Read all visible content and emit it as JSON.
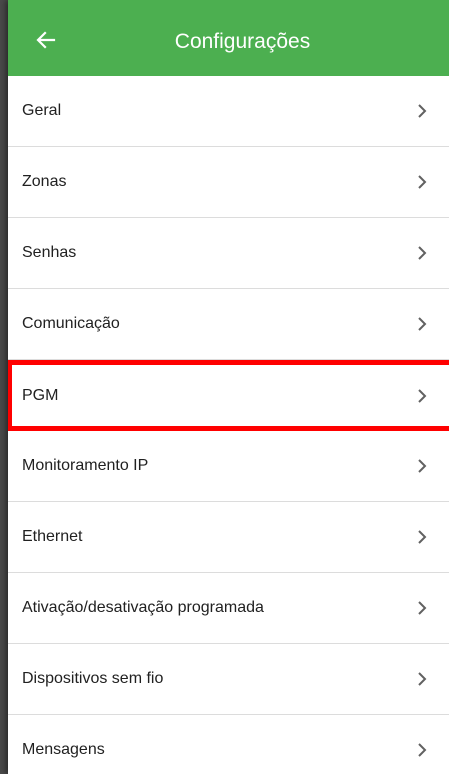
{
  "header": {
    "title": "Configurações",
    "back_icon": "arrow-left-icon",
    "bg_color": "#4caf50"
  },
  "settings": {
    "items": [
      {
        "label": "Geral"
      },
      {
        "label": "Zonas"
      },
      {
        "label": "Senhas"
      },
      {
        "label": "Comunicação"
      },
      {
        "label": "PGM",
        "highlighted": true
      },
      {
        "label": "Monitoramento IP"
      },
      {
        "label": "Ethernet"
      },
      {
        "label": "Ativação/desativação programada"
      },
      {
        "label": "Dispositivos sem fio"
      },
      {
        "label": "Mensagens"
      }
    ],
    "chevron_icon": "chevron-right-icon",
    "highlight_color": "#ff0000"
  }
}
